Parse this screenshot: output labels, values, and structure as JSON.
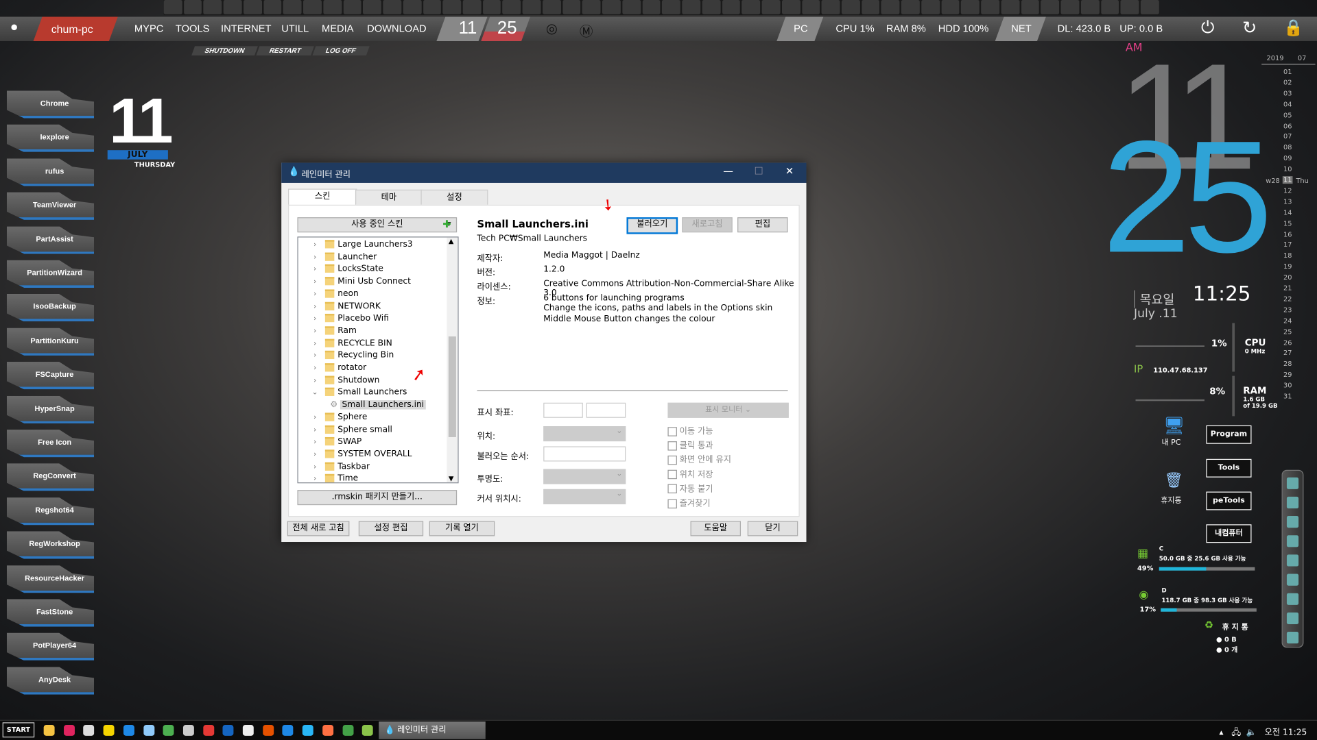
{
  "topbar": {
    "host": "chum-pc",
    "menu": [
      "MYPC",
      "TOOLS",
      "INTERNET",
      "UTILL",
      "MEDIA",
      "DOWNLOAD"
    ],
    "hour": "11",
    "minute": "25",
    "pc": "PC",
    "cpu": "CPU  1%",
    "ram": "RAM  8%",
    "hdd": "HDD  100%",
    "net": "NET",
    "dl": "DL:  423.0 B",
    "up": "UP:  0.0 B"
  },
  "session": {
    "shutdown": "SHUTDOWN",
    "restart": "RESTART",
    "logoff": "LOG OFF"
  },
  "launchers": [
    "Chrome",
    "Iexplore",
    "rufus",
    "TeamViewer",
    "PartAssist",
    "PartitionWizard",
    "IsooBackup",
    "PartitionKuru",
    "FSCapture",
    "HyperSnap",
    "Free  Icon",
    "RegConvert",
    "Regshot64",
    "RegWorkshop",
    "ResourceHacker",
    "FastStone",
    "PotPlayer64",
    "AnyDesk"
  ],
  "date_widget": {
    "day": "11",
    "month": "JULY",
    "weekday": "THURSDAY"
  },
  "dialog": {
    "title": "레인미터 관리",
    "tabs": [
      "스킨",
      "테마",
      "설정"
    ],
    "active_skins_label": "사용 중인 스킨",
    "tree": [
      {
        "name": "Large Launchers3"
      },
      {
        "name": "Launcher"
      },
      {
        "name": "LocksState"
      },
      {
        "name": "Mini Usb Connect"
      },
      {
        "name": "neon"
      },
      {
        "name": "NETWORK"
      },
      {
        "name": "Placebo Wifi"
      },
      {
        "name": "Ram"
      },
      {
        "name": "RECYCLE BIN"
      },
      {
        "name": "Recycling Bin"
      },
      {
        "name": "rotator"
      },
      {
        "name": "Shutdown"
      },
      {
        "name": "Small Launchers",
        "expanded": true
      },
      {
        "name": "Small Launchers.ini",
        "child": true,
        "selected": true
      },
      {
        "name": "Sphere"
      },
      {
        "name": "Sphere small"
      },
      {
        "name": "SWAP"
      },
      {
        "name": "SYSTEM OVERALL"
      },
      {
        "name": "Taskbar"
      },
      {
        "name": "Time"
      }
    ],
    "package_button": ".rmskin 패키지 만들기...",
    "skin_name": "Small Launchers.ini",
    "skin_path": "Tech PC₩Small Launchers",
    "load_button": "불러오기",
    "refresh_button": "새로고침",
    "edit_button": "편집",
    "info": {
      "author_label": "제작자:",
      "author": "Media Maggot | Daelnz",
      "version_label": "버전:",
      "version": "1.2.0",
      "license_label": "라이센스:",
      "license": "Creative Commons Attribution-Non-Commercial-Share Alike 3.0",
      "desc_label": "정보:",
      "desc": [
        "6 buttons for launching programs",
        "Change the icons, paths and labels in the Options skin",
        "Middle Mouse Button changes the colour"
      ]
    },
    "fields": {
      "coords": "표시 좌표:",
      "position": "위치:",
      "load_order": "불러오는 순서:",
      "transparency": "투명도:",
      "on_hover": "커서 위치시:",
      "monitor": "표시 모니터"
    },
    "checks": [
      "이동 가능",
      "클릭 통과",
      "화면 안에 유지",
      "위치 저장",
      "자동 붙기",
      "즐겨찾기"
    ],
    "bottom": {
      "refresh_all": "전체 새로 고침",
      "edit_settings": "설정 편집",
      "open_log": "기록 열기",
      "help": "도움말",
      "close": "닫기"
    }
  },
  "clock": {
    "ampm": "AM",
    "hour": "11",
    "minute": "25",
    "time": "11:25",
    "weekday_ko": "목요일",
    "date": "July .11"
  },
  "calendar": {
    "year": "2019",
    "month": "07",
    "week": "w28",
    "today": "11",
    "today_dow": "Thu",
    "days": [
      "01",
      "02",
      "03",
      "04",
      "05",
      "06",
      "07",
      "08",
      "09",
      "10",
      "11",
      "12",
      "13",
      "14",
      "15",
      "16",
      "17",
      "18",
      "19",
      "20",
      "21",
      "22",
      "23",
      "24",
      "25",
      "26",
      "27",
      "28",
      "29",
      "30",
      "31"
    ]
  },
  "system": {
    "cpu_pct": "1%",
    "cpu_label": "CPU",
    "cpu_freq": "0 MHz",
    "ip_label": "IP",
    "ip": "110.47.68.137",
    "ram_pct": "8%",
    "ram_label": "RAM",
    "ram_used": "1.6 GB",
    "ram_total": "of 19.9 GB"
  },
  "desktop_icons": {
    "mypc": "내 PC",
    "recycle": "휴지통"
  },
  "folders": [
    "Program",
    "Tools",
    "peTools",
    "내컴퓨터"
  ],
  "drives": [
    {
      "letter": "C",
      "text": "50.0 GB 중   25.6 GB 사용 가능",
      "pct": "49%",
      "fill": 0.49
    },
    {
      "letter": "D",
      "text": "118.7 GB 중 98.3 GB 사용 가능",
      "pct": "17%",
      "fill": 0.17
    }
  ],
  "recycle_bin": {
    "title": "휴 지 통",
    "size": "0 B",
    "count": "0 개"
  },
  "taskbar": {
    "start": "START",
    "app": "레인미터 관리",
    "clock": "오전 11:25"
  },
  "colors": {
    "accent_red": "#b83a2e",
    "clock_blue": "#2fa3d6",
    "dialog_title": "#1f3a5f",
    "bar_fill": "#1fb5d9",
    "am_pink": "#e8408a"
  }
}
